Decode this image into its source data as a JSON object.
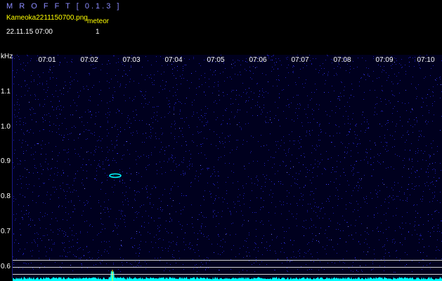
{
  "header": {
    "app_title": "M R O F F T [ 0.1.3 ]",
    "file_name": "Kameoka2211150700.png",
    "meteor_label": "meteor",
    "datetime": "22.11.15 07:00",
    "meteor_count": "1"
  },
  "axis": {
    "unit": "kHz",
    "time_labels": [
      "07:01",
      "07:02",
      "07:03",
      "07:04",
      "07:05",
      "07:06",
      "07:07",
      "07:08",
      "07:09",
      "07:10"
    ],
    "freq_labels": [
      "1.1",
      "1.0",
      "0.9",
      "0.8",
      "0.7",
      "0.6"
    ]
  },
  "colors": {
    "background": "#000000",
    "title": "#8c8cff",
    "highlight": "#ffff00",
    "noise": "#1e1eb4",
    "signal": "#00ffff"
  },
  "detection": {
    "meteor_time": "07:02"
  }
}
